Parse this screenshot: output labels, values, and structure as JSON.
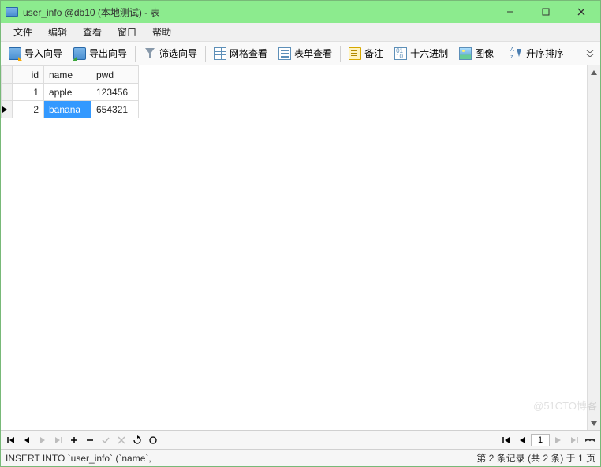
{
  "window": {
    "title": "user_info @db10 (本地测试) - 表"
  },
  "menu": {
    "file": "文件",
    "edit": "编辑",
    "view": "查看",
    "window": "窗口",
    "help": "帮助"
  },
  "toolbar": {
    "import_wizard": "导入向导",
    "export_wizard": "导出向导",
    "filter_wizard": "筛选向导",
    "grid_view": "网格查看",
    "form_view": "表单查看",
    "memo": "备注",
    "hex": "十六进制",
    "image": "图像",
    "sort_asc": "升序排序"
  },
  "table": {
    "columns": {
      "id": "id",
      "name": "name",
      "pwd": "pwd"
    },
    "rows": [
      {
        "id": "1",
        "name": "apple",
        "pwd": "123456",
        "current": false,
        "selected_name": false
      },
      {
        "id": "2",
        "name": "banana",
        "pwd": "654321",
        "current": true,
        "selected_name": true
      }
    ]
  },
  "nav": {
    "page": "1"
  },
  "status": {
    "sql": "INSERT INTO `user_info` (`name`,",
    "record_info": "第 2 条记录 (共 2 条) 于 1 页"
  },
  "watermark": "@51CTO博客"
}
